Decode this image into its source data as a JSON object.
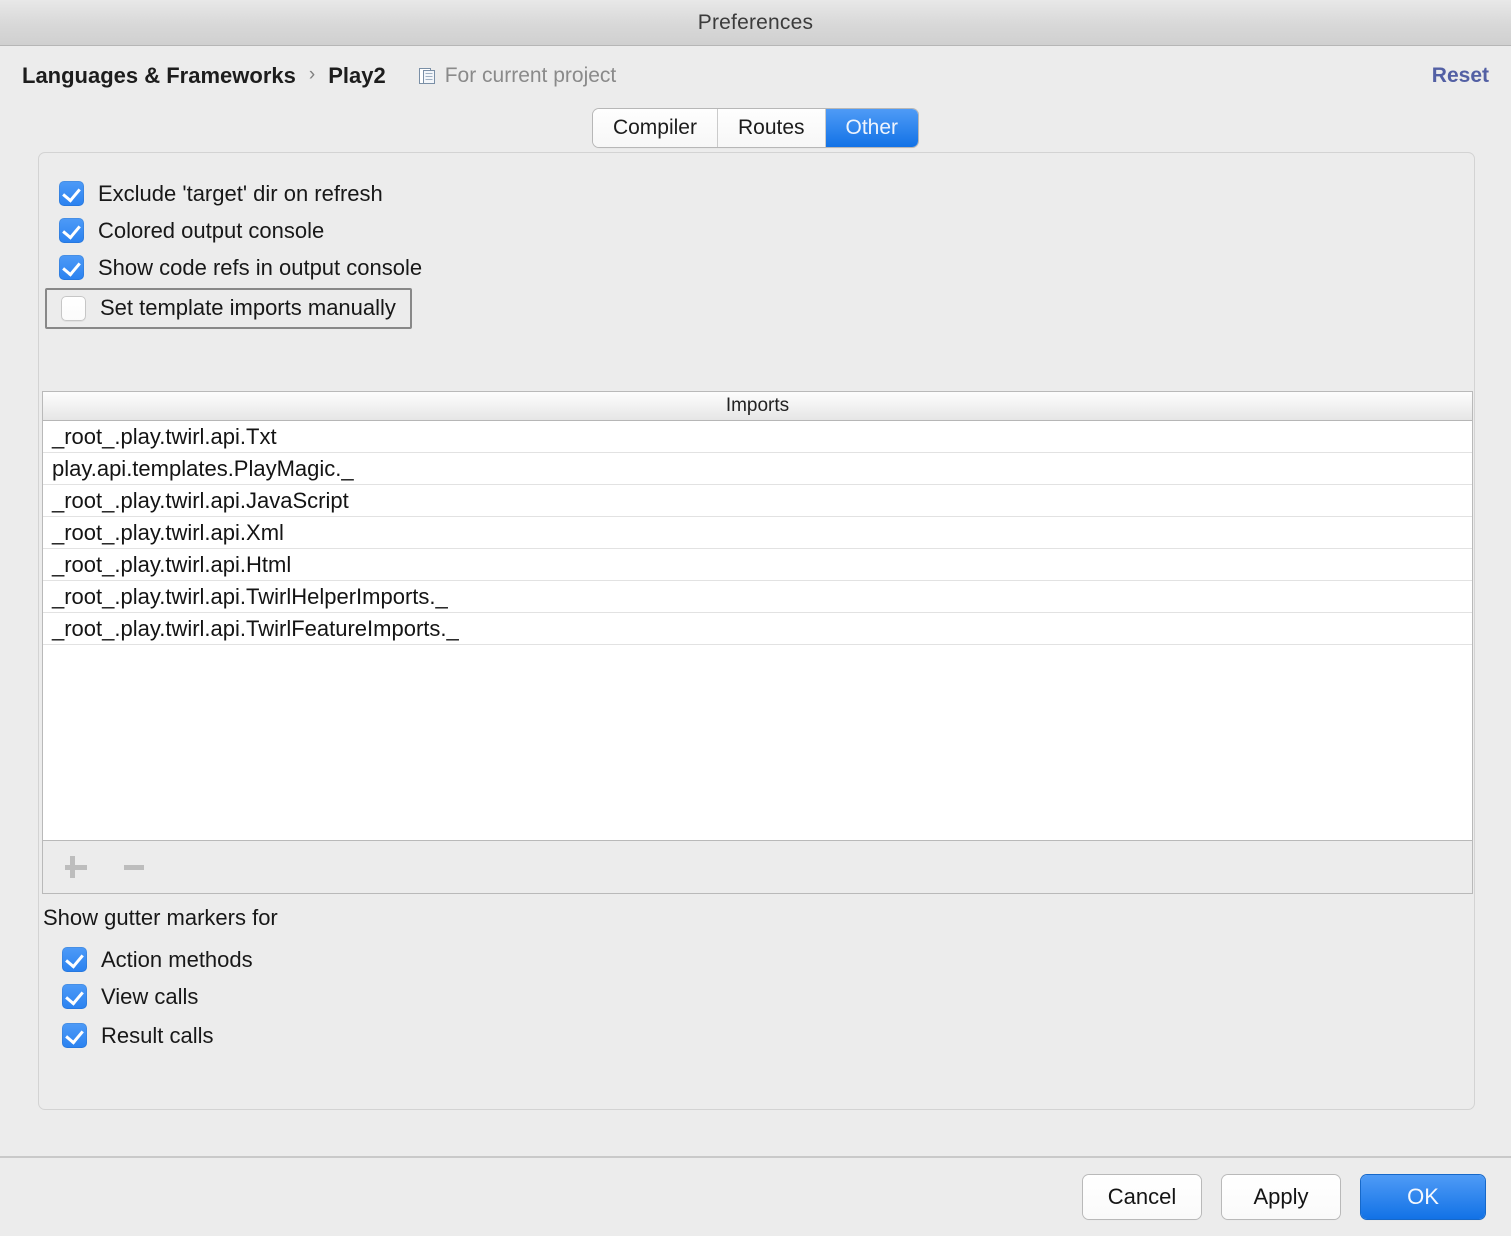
{
  "window": {
    "title": "Preferences"
  },
  "header": {
    "breadcrumb": [
      "Languages & Frameworks",
      "Play2"
    ],
    "separator": "›",
    "scope_label": "For current project",
    "scope_icon": "module-icon",
    "reset_label": "Reset",
    "reset_color": "#5360a4"
  },
  "tabs": [
    {
      "label": "Compiler",
      "active": false
    },
    {
      "label": "Routes",
      "active": false
    },
    {
      "label": "Other",
      "active": true
    }
  ],
  "options": [
    {
      "label": "Exclude 'target' dir on refresh",
      "checked": true,
      "focused": false
    },
    {
      "label": "Colored output console",
      "checked": true,
      "focused": false
    },
    {
      "label": "Show code refs in output console",
      "checked": true,
      "focused": false
    },
    {
      "label": "Set template imports manually",
      "checked": false,
      "focused": true
    }
  ],
  "imports_table": {
    "column_header": "Imports",
    "rows": [
      "_root_.play.twirl.api.Txt",
      "play.api.templates.PlayMagic._",
      "_root_.play.twirl.api.JavaScript",
      "_root_.play.twirl.api.Xml",
      "_root_.play.twirl.api.Html",
      "_root_.play.twirl.api.TwirlHelperImports._",
      "_root_.play.twirl.api.TwirlFeatureImports._"
    ],
    "toolbar": [
      {
        "icon": "plus-icon",
        "enabled": false
      },
      {
        "icon": "minus-icon",
        "enabled": false
      }
    ]
  },
  "gutter_section": {
    "title": "Show gutter markers for",
    "items": [
      {
        "label": "Action methods",
        "checked": true,
        "focused": false
      },
      {
        "label": "View calls",
        "checked": true,
        "focused": false
      },
      {
        "label": "Result calls",
        "checked": true,
        "focused": true
      }
    ]
  },
  "footer": {
    "buttons": [
      {
        "label": "Cancel",
        "style": "plain"
      },
      {
        "label": "Apply",
        "style": "plain"
      },
      {
        "label": "OK",
        "style": "primary"
      }
    ]
  },
  "colors": {
    "accent_blue": "#2a82f0",
    "window_bg": "#ececec",
    "link": "#5360a4",
    "text": "#181818",
    "muted_text": "#8a8a8a"
  }
}
